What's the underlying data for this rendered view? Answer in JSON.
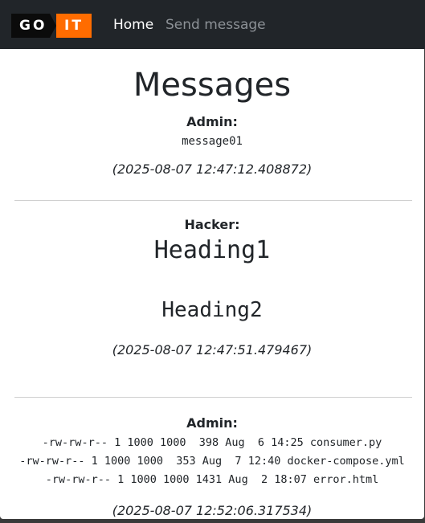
{
  "nav": {
    "logo_go": "GO",
    "logo_it": "IT",
    "links": [
      "Home",
      "Send message"
    ]
  },
  "page": {
    "title": "Messages"
  },
  "messages": [
    {
      "author": "Admin:",
      "lines": [
        "message01"
      ],
      "timestamp": "(2025-08-07 12:47:12.408872)"
    },
    {
      "author": "Hacker:",
      "headings": [
        "Heading1",
        "Heading2"
      ],
      "timestamp": "(2025-08-07 12:47:51.479467)"
    },
    {
      "author": "Admin:",
      "lines": [
        "-rw-rw-r-- 1 1000 1000  398 Aug  6 14:25 consumer.py",
        "-rw-rw-r-- 1 1000 1000  353 Aug  7 12:40 docker-compose.yml",
        "-rw-rw-r-- 1 1000 1000 1431 Aug  2 18:07 error.html"
      ],
      "timestamp": "(2025-08-07 12:52:06.317534)"
    }
  ],
  "colors": {
    "navbar_bg": "#212529",
    "logo_orange": "#ff6c00",
    "nav_active": "#ffffff",
    "nav_inactive": "#8c9196"
  }
}
